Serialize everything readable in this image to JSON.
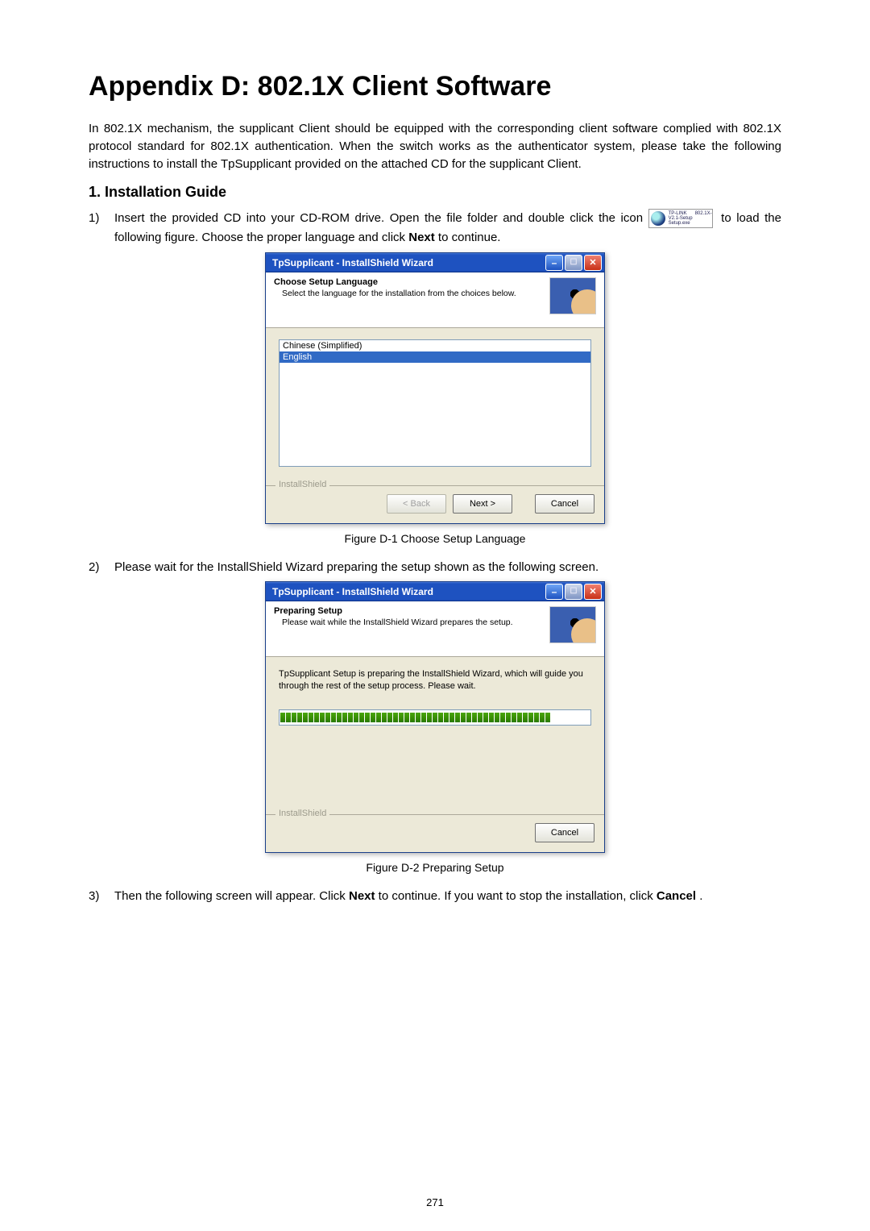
{
  "page": {
    "number": "271",
    "title": "Appendix D: 802.1X Client Software",
    "intro": "In 802.1X mechanism, the supplicant Client should be equipped with the corresponding client software complied with 802.1X protocol standard for 802.1X authentication. When the switch works as the authenticator system, please take the following instructions to install the TpSupplicant provided on the attached CD for the supplicant Client.",
    "section1_heading": "1.    Installation Guide",
    "steps": {
      "s1_a": "Insert the provided CD into your CD-ROM drive. Open the file folder and double click the icon ",
      "s1_icon_label": "TP-LINK 802.1X-V2.1-Setup Setup.exe",
      "s1_b": " to load the following figure. Choose the proper language and click ",
      "s1_next": "Next",
      "s1_c": " to continue.",
      "s2": "Please wait for the InstallShield Wizard preparing the setup shown as the following screen.",
      "s3_a": "Then the following screen will appear. Click ",
      "s3_next": "Next",
      "s3_b": " to continue. If you want to stop the installation, click ",
      "s3_cancel": "Cancel",
      "s3_c": "."
    }
  },
  "captions": {
    "fig1": "Figure D-1 Choose Setup Language",
    "fig2": "Figure D-2 Preparing Setup"
  },
  "installer1": {
    "window_title": "TpSupplicant - InstallShield Wizard",
    "banner_title": "Choose Setup Language",
    "banner_sub": "Select the language for the installation from the choices below.",
    "options": [
      "Chinese (Simplified)",
      "English"
    ],
    "footer_label": "InstallShield",
    "back": "< Back",
    "next": "Next >",
    "cancel": "Cancel"
  },
  "installer2": {
    "window_title": "TpSupplicant - InstallShield Wizard",
    "banner_title": "Preparing Setup",
    "banner_sub": "Please wait while the InstallShield Wizard prepares the setup.",
    "body_text": "TpSupplicant Setup is preparing the InstallShield Wizard, which will guide you through the rest of the setup process. Please wait.",
    "footer_label": "InstallShield",
    "cancel": "Cancel"
  }
}
